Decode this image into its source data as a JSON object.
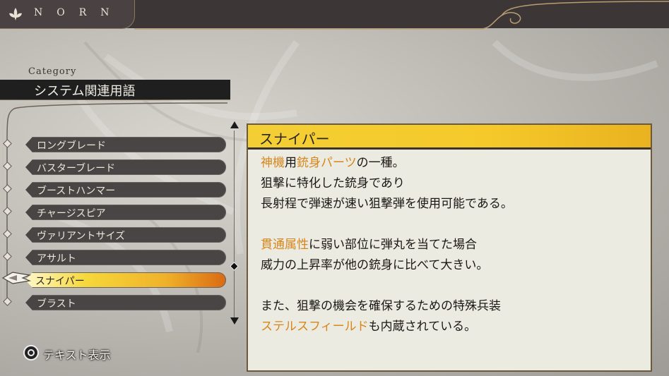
{
  "brand": {
    "name": "NORN",
    "icon": "fleur-icon"
  },
  "category": {
    "caption": "Category",
    "title": "システム関連用語"
  },
  "list": {
    "items": [
      {
        "label": "ロングブレード"
      },
      {
        "label": "バスターブレード"
      },
      {
        "label": "ブーストハンマー"
      },
      {
        "label": "チャージスピア"
      },
      {
        "label": "ヴァリアントサイズ"
      },
      {
        "label": "アサルト"
      },
      {
        "label": "スナイパー",
        "selected": true
      },
      {
        "label": "ブラスト"
      }
    ]
  },
  "detail": {
    "title": "スナイパー",
    "paragraphs": [
      [
        [
          {
            "t": "神機",
            "hl": true
          },
          {
            "t": "用"
          },
          {
            "t": "銃身パーツ",
            "hl": true
          },
          {
            "t": "の一種。"
          }
        ],
        [
          {
            "t": "狙撃に特化した銃身であり"
          }
        ],
        [
          {
            "t": "長射程で弾速が速い狙撃弾を使用可能である。"
          }
        ]
      ],
      [
        [
          {
            "t": "貫通属性",
            "hl": true
          },
          {
            "t": "に弱い部位に弾丸を当てた場合"
          }
        ],
        [
          {
            "t": "威力の上昇率が他の銃身に比べて大きい。"
          }
        ]
      ],
      [
        [
          {
            "t": "また、狙撃の機会を確保するための特殊兵装"
          }
        ],
        [
          {
            "t": "ステルスフィールド",
            "hl": true
          },
          {
            "t": "も内蔵されている。"
          }
        ]
      ]
    ]
  },
  "hint": {
    "button_icon": "circle-button-icon",
    "label": "テキスト表示"
  },
  "colors": {
    "highlight": "#d6861a",
    "header_yellow": "#f3cf35",
    "selected_gradient_start": "#fff8c8",
    "selected_gradient_end": "#d96a14",
    "item_bg": "#4a4545",
    "topbar": "#3d3636"
  }
}
